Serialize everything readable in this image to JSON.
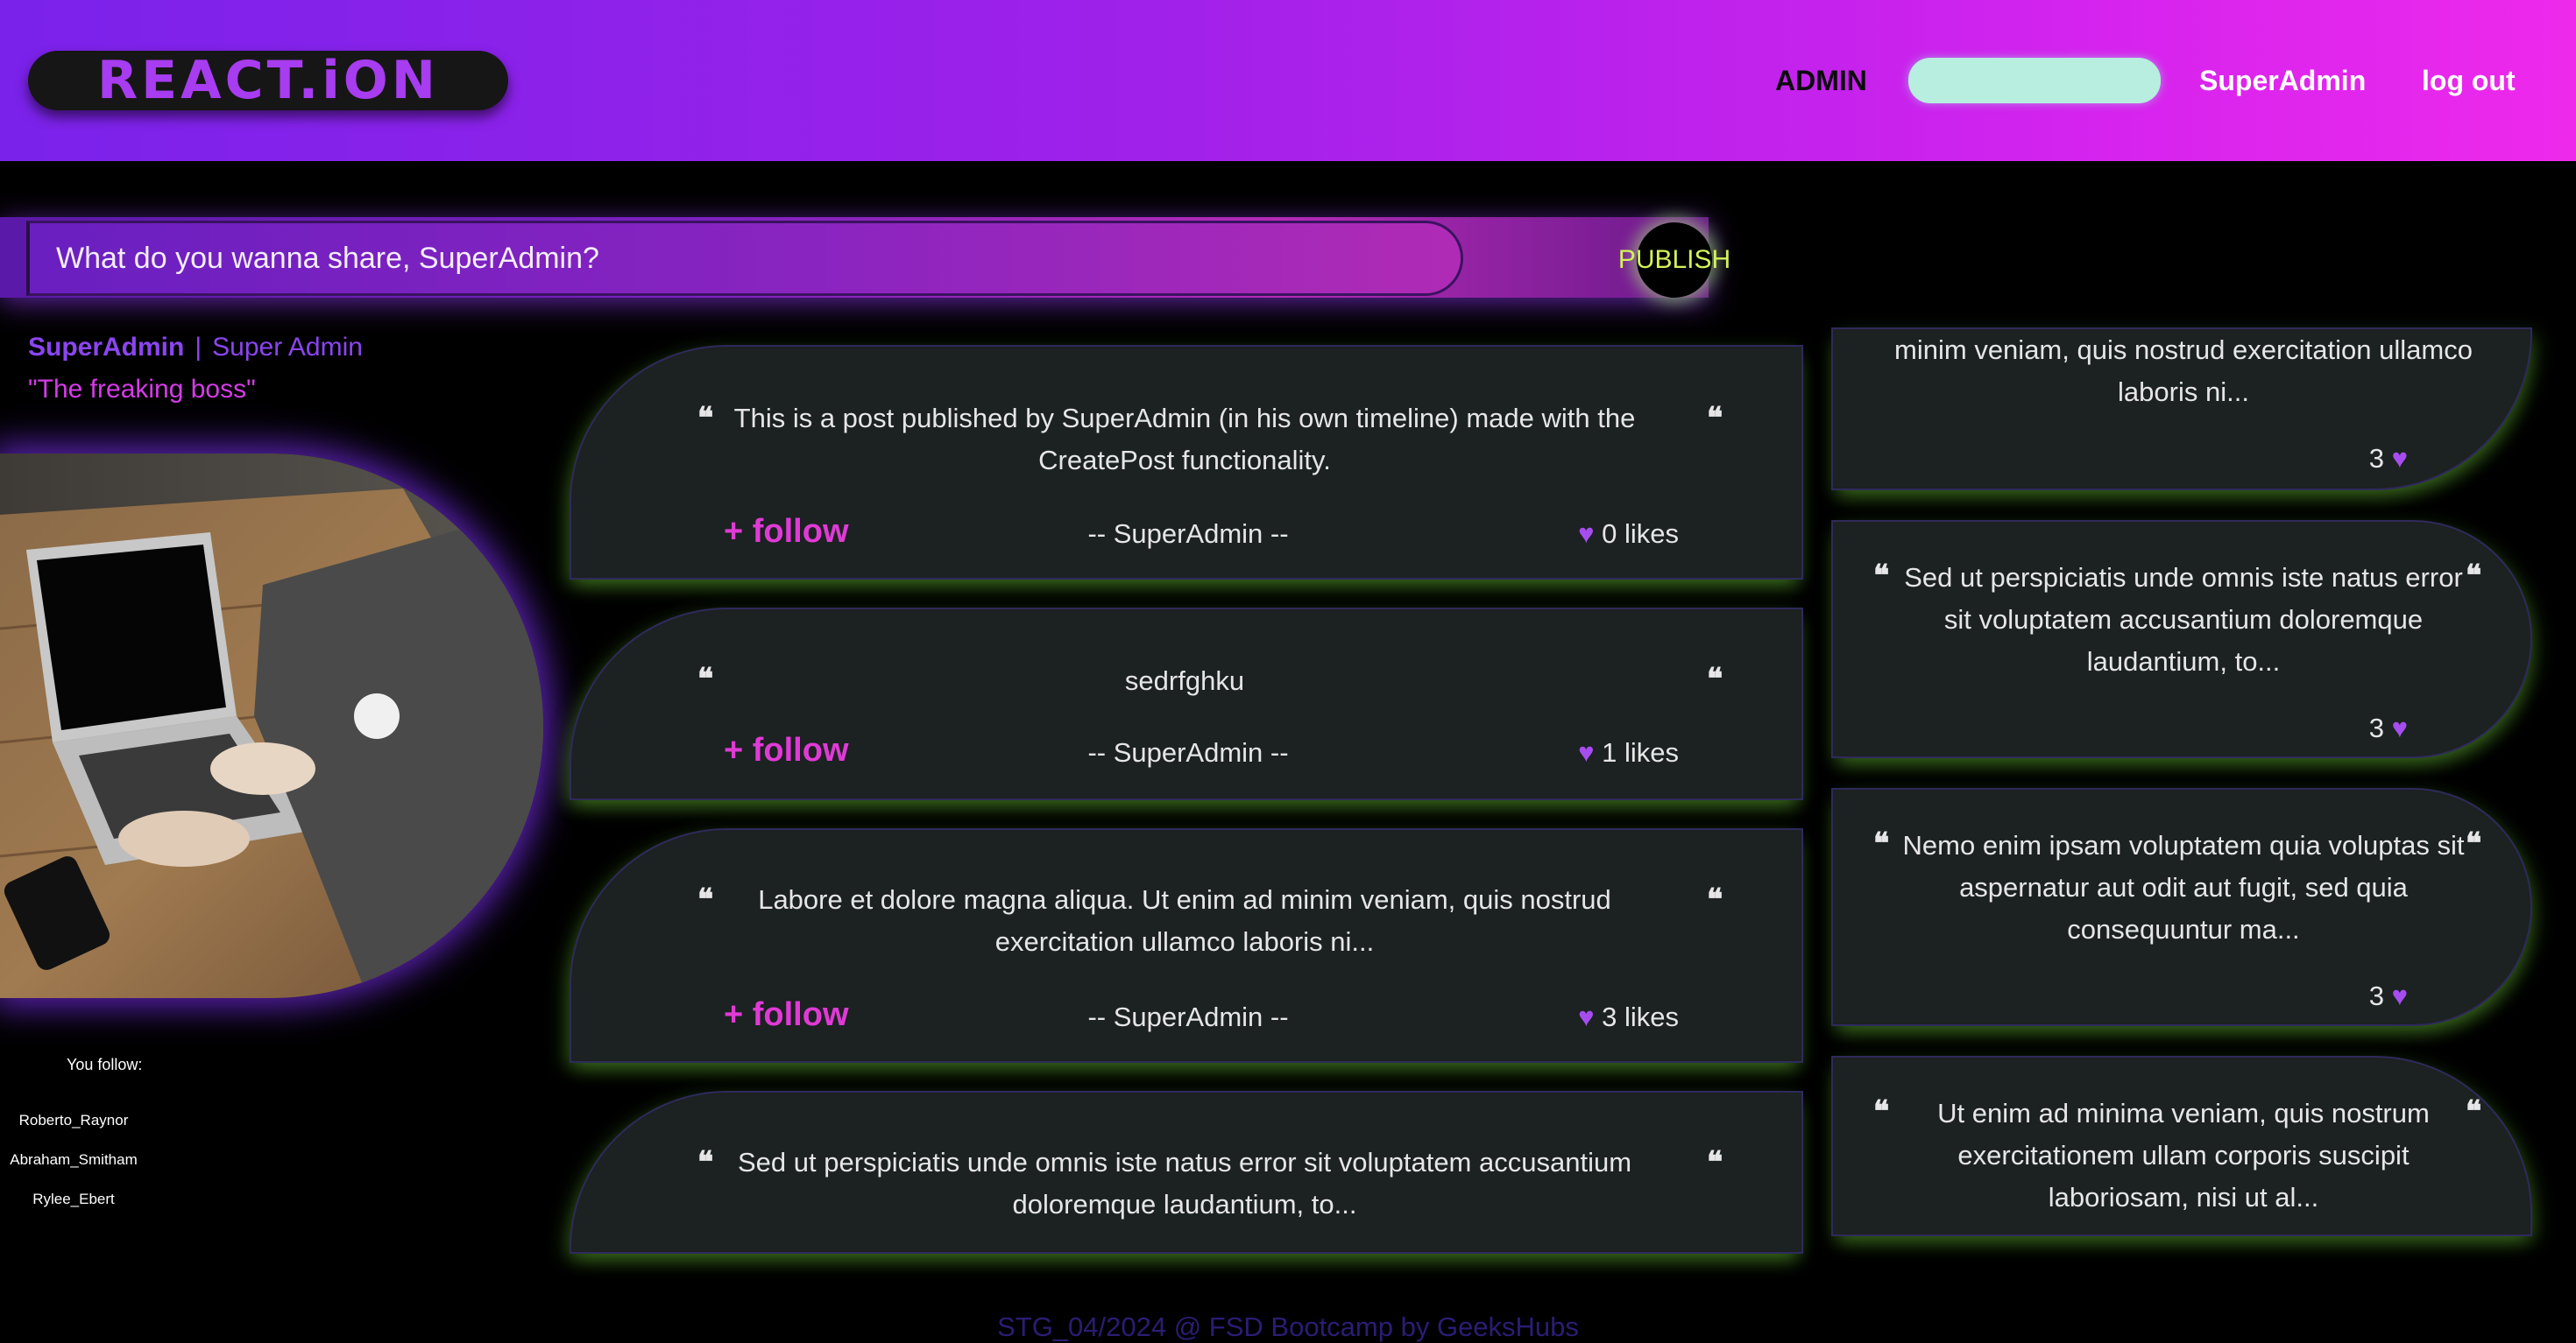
{
  "header": {
    "logo": "REACT.iON",
    "nav": {
      "admin": "ADMIN",
      "user": "SuperAdmin",
      "logout": "log out"
    }
  },
  "share": {
    "placeholder": "What do you wanna share, SuperAdmin?",
    "publish_label": "PUBLISH"
  },
  "profile": {
    "name": "SuperAdmin",
    "separator": "|",
    "role": "Super Admin",
    "quote": "\"The freaking boss\"",
    "follow_title": "You follow:",
    "follows": [
      "Roberto_Raynor",
      "Abraham_Smitham",
      "Rylee_Ebert"
    ]
  },
  "posts": [
    {
      "text": "This is a post published by SuperAdmin (in his own timeline) made with the CreatePost functionality.",
      "follow_label": "+ follow",
      "author": "-- SuperAdmin --",
      "likes": "0 likes"
    },
    {
      "text": "sedrfghku",
      "follow_label": "+ follow",
      "author": "-- SuperAdmin --",
      "likes": "1 likes"
    },
    {
      "text": "Labore et dolore magna aliqua. Ut enim ad minim veniam, quis nostrud exercitation ullamco laboris ni...",
      "follow_label": "+ follow",
      "author": "-- SuperAdmin --",
      "likes": "3 likes"
    },
    {
      "text": "Sed ut perspiciatis unde omnis iste natus error sit voluptatem accusantium doloremque laudantium, to...",
      "follow_label": "",
      "author": "",
      "likes": ""
    }
  ],
  "side_posts": [
    {
      "text": "minim veniam, quis nostrud exercitation ullamco laboris ni...",
      "likes": "3"
    },
    {
      "text": "Sed ut perspiciatis unde omnis iste natus error sit voluptatem accusantium doloremque laudantium, to...",
      "likes": "3"
    },
    {
      "text": "Nemo enim ipsam voluptatem quia voluptas sit aspernatur aut odit aut fugit, sed quia consequuntur ma...",
      "likes": "3"
    },
    {
      "text": "Ut enim ad minima veniam, quis nostrum exercitationem ullam corporis suscipit laboriosam, nisi ut al...",
      "likes": ""
    }
  ],
  "icons": {
    "like": "heart-icon",
    "quote": "quote-icon"
  },
  "colors": {
    "accent": "#d63be8",
    "brand_purple": "#8b45f0",
    "card_bg": "#1c2121",
    "search_bg": "#b7eedf"
  },
  "footer": "STG_04/2024 @ FSD Bootcamp by GeeksHubs"
}
